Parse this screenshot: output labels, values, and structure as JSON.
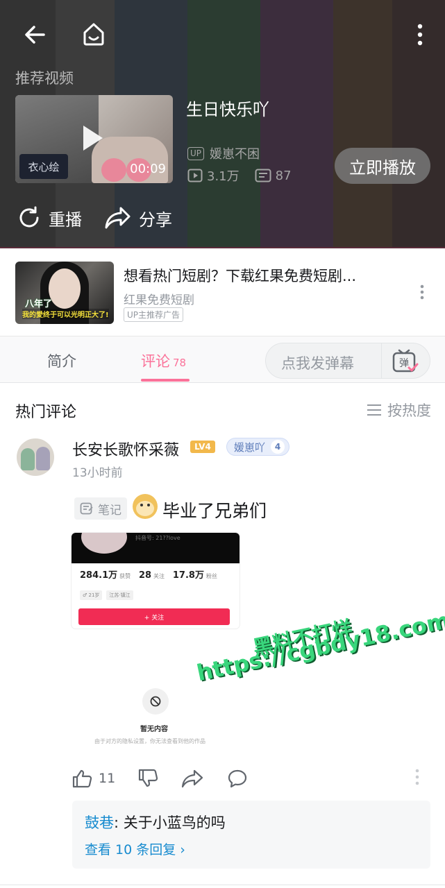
{
  "player_end": {
    "back_icon": "back-arrow-icon",
    "home_icon": "home-icon",
    "more_icon": "more-vertical-icon",
    "recommend_title": "推荐视频",
    "video": {
      "title": "生日快乐吖",
      "duration": "00:09",
      "thumb_logo": "衣心绘",
      "up_badge": "UP",
      "uploader": "媛崽不困",
      "plays": "3.1万",
      "danmaku": "87"
    },
    "play_now_label": "立即播放",
    "replay_label": "重播",
    "share_label": "分享"
  },
  "ad": {
    "thumb_caption1": "八年了",
    "thumb_caption2": "我的愛终于可以光明正大了!",
    "title": "想看热门短剧？下载红果免费短剧...",
    "source": "红果免费短剧",
    "badge": "UP主推荐广告"
  },
  "tabs": {
    "intro": "简介",
    "comments": "评论",
    "comments_count": "78",
    "danmaku_placeholder": "点我发弹幕",
    "danmaku_icon_text": "弹"
  },
  "comments": {
    "section_title": "热门评论",
    "sort_label": "按热度",
    "items": [
      {
        "user": "长安长歌怀采薇",
        "level": "LV4",
        "fan_badge": "媛崽吖",
        "fan_level": "4",
        "time": "13小时前",
        "note_label": "笔记",
        "text": "毕业了兄弟们",
        "image": {
          "header_text": "抖音号: 21??love",
          "stat1_value": "284.1万",
          "stat1_label": "获赞",
          "stat2_value": "28",
          "stat2_label": "关注",
          "stat3_value": "17.8万",
          "stat3_label": "粉丝",
          "tag1": "♂ 21岁",
          "tag2": "江苏·镇江",
          "follow_label": "+ 关注",
          "empty_title": "暂无内容",
          "empty_sub": "由于对方的隐私设置，你无法查看到他的作品"
        },
        "likes": "11",
        "reply": {
          "user": "鼓巷",
          "text": ": 关于小蓝鸟的吗",
          "more": "查看 10 条回复 ›"
        }
      }
    ]
  },
  "watermark": {
    "line1": "黑料不打烊",
    "line2": "https://cgbdy18.com"
  }
}
